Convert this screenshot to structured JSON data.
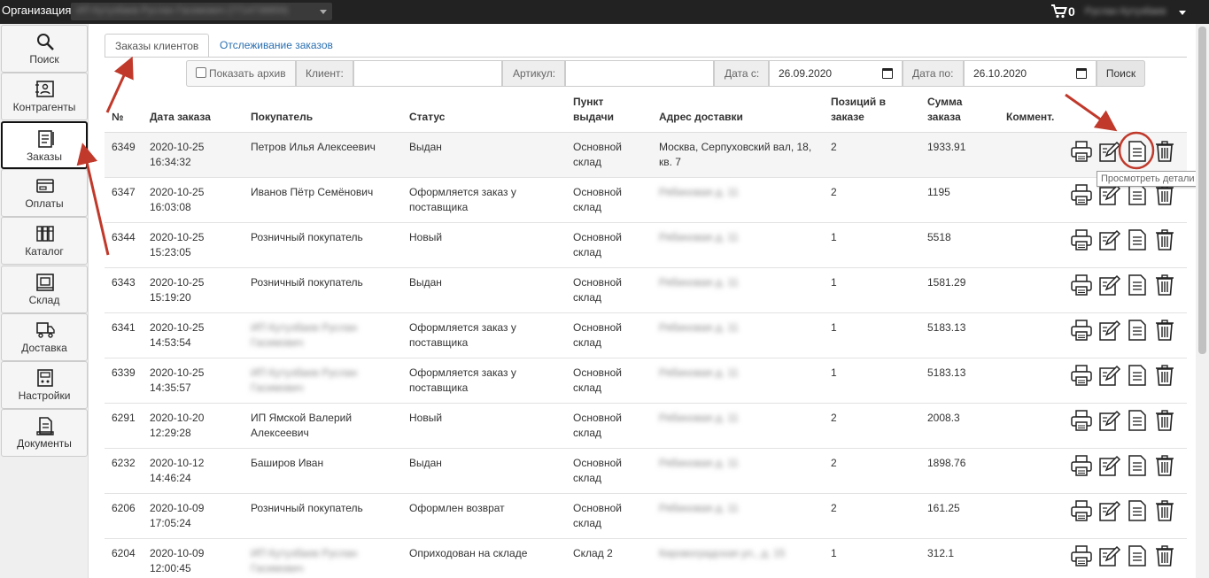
{
  "topbar": {
    "org_label": "Организация:",
    "org_value": "ИП Кутузбаев Руслан Гасимович (7714738859)",
    "cart_count": "0",
    "user_name": "Руслан Кутузбаев"
  },
  "sidebar": {
    "items": [
      {
        "label": "Поиск",
        "icon": "search-icon"
      },
      {
        "label": "Контрагенты",
        "icon": "contacts-icon"
      },
      {
        "label": "Заказы",
        "icon": "orders-icon"
      },
      {
        "label": "Оплаты",
        "icon": "payment-icon"
      },
      {
        "label": "Каталог",
        "icon": "catalog-icon"
      },
      {
        "label": "Склад",
        "icon": "warehouse-icon"
      },
      {
        "label": "Доставка",
        "icon": "delivery-icon"
      },
      {
        "label": "Настройки",
        "icon": "settings-icon"
      },
      {
        "label": "Документы",
        "icon": "documents-icon"
      }
    ],
    "active_index": 2
  },
  "tabs": {
    "active": "Заказы клиентов",
    "other": "Отслеживание заказов"
  },
  "filter": {
    "archive_label": "Показать архив",
    "client_label": "Клиент:",
    "client_value": "",
    "article_label": "Артикул:",
    "article_value": "",
    "date_from_label": "Дата с:",
    "date_from_value": "26.09.2020",
    "date_to_label": "Дата по:",
    "date_to_value": "26.10.2020",
    "search_label": "Поиск"
  },
  "table": {
    "headers": {
      "num": "№",
      "date": "Дата заказа",
      "buyer": "Покупатель",
      "status": "Статус",
      "pickup_1": "Пункт",
      "pickup_2": "выдачи",
      "address": "Адрес доставки",
      "positions_1": "Позиций в",
      "positions_2": "заказе",
      "sum_1": "Сумма",
      "sum_2": "заказа",
      "comment": "Коммент."
    },
    "rows": [
      {
        "num": "6349",
        "date": "2020-10-25",
        "time": "16:34:32",
        "buyer_1": "Петров Илья Алексеевич",
        "buyer_2": "",
        "buyer_blur": false,
        "status_1": "Выдан",
        "status_2": "",
        "pickup_1": "Основной",
        "pickup_2": "склад",
        "address_1": "Москва, Серпуховский вал, 18,",
        "address_2": "кв. 7",
        "address_blur": false,
        "positions": "2",
        "sum": "1933.91"
      },
      {
        "num": "6347",
        "date": "2020-10-25",
        "time": "16:03:08",
        "buyer_1": "Иванов Пётр Семёнович",
        "buyer_2": "",
        "buyer_blur": false,
        "status_1": "Оформляется заказ у",
        "status_2": "поставщика",
        "pickup_1": "Основной",
        "pickup_2": "склад",
        "address_1": "Рябиновая д. 11",
        "address_2": "",
        "address_blur": true,
        "positions": "2",
        "sum": "1195"
      },
      {
        "num": "6344",
        "date": "2020-10-25",
        "time": "15:23:05",
        "buyer_1": "Розничный покупатель",
        "buyer_2": "",
        "buyer_blur": false,
        "status_1": "Новый",
        "status_2": "",
        "pickup_1": "Основной",
        "pickup_2": "склад",
        "address_1": "Рябиновая д. 11",
        "address_2": "",
        "address_blur": true,
        "positions": "1",
        "sum": "5518"
      },
      {
        "num": "6343",
        "date": "2020-10-25",
        "time": "15:19:20",
        "buyer_1": "Розничный покупатель",
        "buyer_2": "",
        "buyer_blur": false,
        "status_1": "Выдан",
        "status_2": "",
        "pickup_1": "Основной",
        "pickup_2": "склад",
        "address_1": "Рябиновая д. 11",
        "address_2": "",
        "address_blur": true,
        "positions": "1",
        "sum": "1581.29"
      },
      {
        "num": "6341",
        "date": "2020-10-25",
        "time": "14:53:54",
        "buyer_1": "ИП Кутузбаев Руслан",
        "buyer_2": "Гасимович",
        "buyer_blur": true,
        "status_1": "Оформляется заказ у",
        "status_2": "поставщика",
        "pickup_1": "Основной",
        "pickup_2": "склад",
        "address_1": "Рябиновая д. 11",
        "address_2": "",
        "address_blur": true,
        "positions": "1",
        "sum": "5183.13"
      },
      {
        "num": "6339",
        "date": "2020-10-25",
        "time": "14:35:57",
        "buyer_1": "ИП Кутузбаев Руслан",
        "buyer_2": "Гасимович",
        "buyer_blur": true,
        "status_1": "Оформляется заказ у",
        "status_2": "поставщика",
        "pickup_1": "Основной",
        "pickup_2": "склад",
        "address_1": "Рябиновая д. 11",
        "address_2": "",
        "address_blur": true,
        "positions": "1",
        "sum": "5183.13"
      },
      {
        "num": "6291",
        "date": "2020-10-20",
        "time": "12:29:28",
        "buyer_1": "ИП Ямской Валерий",
        "buyer_2": "Алексеевич",
        "buyer_blur": false,
        "status_1": "Новый",
        "status_2": "",
        "pickup_1": "Основной",
        "pickup_2": "склад",
        "address_1": "Рябиновая д. 11",
        "address_2": "",
        "address_blur": true,
        "positions": "2",
        "sum": "2008.3"
      },
      {
        "num": "6232",
        "date": "2020-10-12",
        "time": "14:46:24",
        "buyer_1": "Баширов Иван",
        "buyer_2": "",
        "buyer_blur": false,
        "status_1": "Выдан",
        "status_2": "",
        "pickup_1": "Основной",
        "pickup_2": "склад",
        "address_1": "Рябиновая д. 11",
        "address_2": "",
        "address_blur": true,
        "positions": "2",
        "sum": "1898.76"
      },
      {
        "num": "6206",
        "date": "2020-10-09",
        "time": "17:05:24",
        "buyer_1": "Розничный покупатель",
        "buyer_2": "",
        "buyer_blur": false,
        "status_1": "Оформлен возврат",
        "status_2": "",
        "pickup_1": "Основной",
        "pickup_2": "склад",
        "address_1": "Рябиновая д. 11",
        "address_2": "",
        "address_blur": true,
        "positions": "2",
        "sum": "161.25"
      },
      {
        "num": "6204",
        "date": "2020-10-09",
        "time": "12:00:45",
        "buyer_1": "ИП Кутузбаев Руслан",
        "buyer_2": "Гасимович",
        "buyer_blur": true,
        "status_1": "Оприходован на складе",
        "status_2": "",
        "pickup_1": "Склад 2",
        "pickup_2": "",
        "address_1": "Кировоградская ул., д. 15",
        "address_2": "",
        "address_blur": true,
        "positions": "1",
        "sum": "312.1"
      }
    ]
  },
  "tooltip": "Просмотреть детали",
  "colors": {
    "accent_link": "#2a6fb0",
    "annotation_red": "#c0392b",
    "topbar": "#222222"
  }
}
